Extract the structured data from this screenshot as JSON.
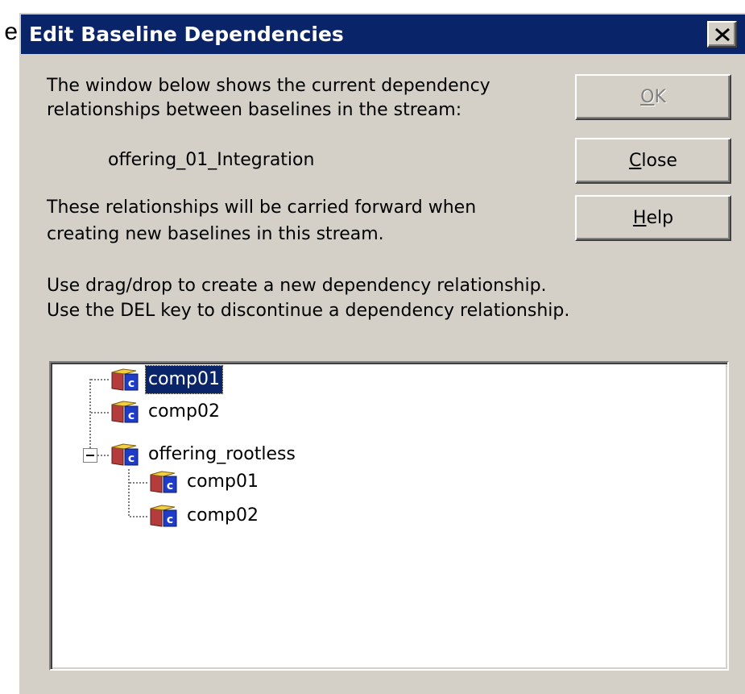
{
  "background_fragment": "e",
  "window": {
    "title": "Edit Baseline Dependencies"
  },
  "description": {
    "line1": "The window below shows the current dependency",
    "line2": "relationships between baselines in the stream:",
    "stream_name": "offering_01_Integration",
    "line3": "These relationships will be carried forward when",
    "line4": "creating new baselines in this stream.",
    "instruction1": "Use drag/drop to create a new dependency relationship.",
    "instruction2": "Use the DEL key to discontinue a dependency relationship."
  },
  "buttons": {
    "ok": {
      "mnemonic": "O",
      "rest": "K",
      "enabled": false
    },
    "close": {
      "mnemonic": "C",
      "rest": "lose",
      "enabled": true
    },
    "help": {
      "mnemonic": "H",
      "rest": "elp",
      "enabled": true
    }
  },
  "tree": {
    "items": [
      {
        "label": "comp01",
        "level": 0,
        "selected": true,
        "icon": "component-cube-icon"
      },
      {
        "label": "comp02",
        "level": 0,
        "selected": false,
        "icon": "component-cube-icon"
      },
      {
        "label": "offering_rootless",
        "level": 0,
        "selected": false,
        "expanded": true,
        "icon": "component-cube-icon"
      },
      {
        "label": "comp01",
        "level": 1,
        "selected": false,
        "icon": "component-cube-icon"
      },
      {
        "label": "comp02",
        "level": 1,
        "selected": false,
        "icon": "component-cube-icon"
      }
    ]
  },
  "colors": {
    "title_bar": "#0a246a",
    "dialog_face": "#d4d0c8",
    "selection": "#0a246a"
  }
}
